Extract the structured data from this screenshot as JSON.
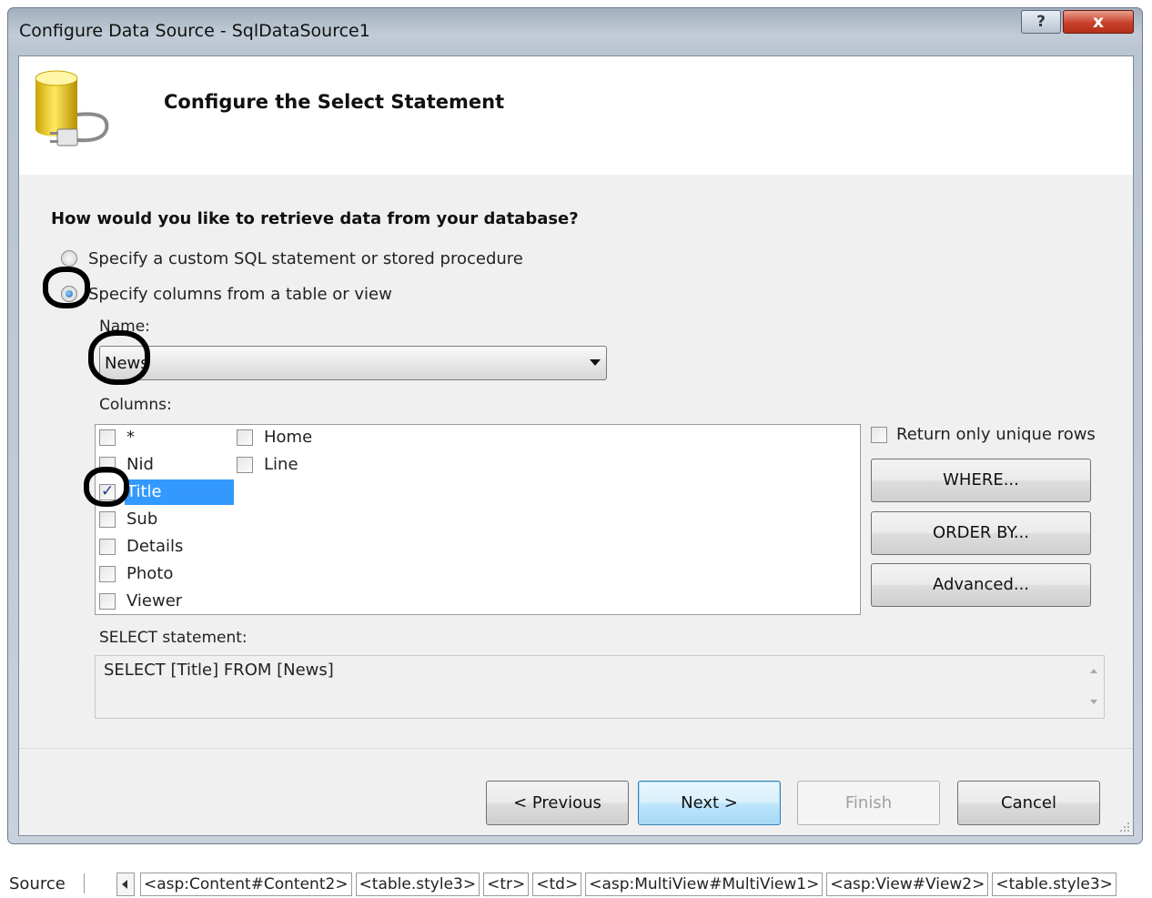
{
  "window": {
    "title": "Configure Data Source - SqlDataSource1",
    "help_label": "?",
    "close_label": "x"
  },
  "header": {
    "title": "Configure the Select Statement",
    "icon": "database-plug-icon"
  },
  "question": "How would you like to retrieve data from your database?",
  "radios": {
    "custom_sql": {
      "label": "Specify a custom SQL statement or stored procedure",
      "checked": false
    },
    "table_view": {
      "label": "Specify columns from a table or view",
      "checked": true
    }
  },
  "name_field": {
    "label": "Name:",
    "value": "News"
  },
  "columns": {
    "label": "Columns:",
    "items": [
      {
        "label": "*",
        "checked": false
      },
      {
        "label": "Nid",
        "checked": false
      },
      {
        "label": "Title",
        "checked": true,
        "selected": true
      },
      {
        "label": "Sub",
        "checked": false
      },
      {
        "label": "Details",
        "checked": false
      },
      {
        "label": "Photo",
        "checked": false
      },
      {
        "label": "Viewer",
        "checked": false
      },
      {
        "label": "Home",
        "checked": false
      },
      {
        "label": "Line",
        "checked": false
      }
    ]
  },
  "options": {
    "unique_rows_label": "Return only unique rows",
    "where_label": "WHERE...",
    "order_by_label": "ORDER BY...",
    "advanced_label": "Advanced..."
  },
  "select_statement": {
    "label": "SELECT statement:",
    "text": "SELECT [Title] FROM [News]"
  },
  "buttons": {
    "previous": "< Previous",
    "next": "Next >",
    "finish": "Finish",
    "cancel": "Cancel"
  },
  "statusbar": {
    "source_label": "Source",
    "breadcrumbs": [
      "<asp:Content#Content2>",
      "<table.style3>",
      "<tr>",
      "<td>",
      "<asp:MultiView#MultiView1>",
      "<asp:View#View2>",
      "<table.style3>"
    ]
  },
  "colors": {
    "selection": "#3399ff",
    "annotation_mark": "#000000",
    "close_button": "#c8412b"
  }
}
